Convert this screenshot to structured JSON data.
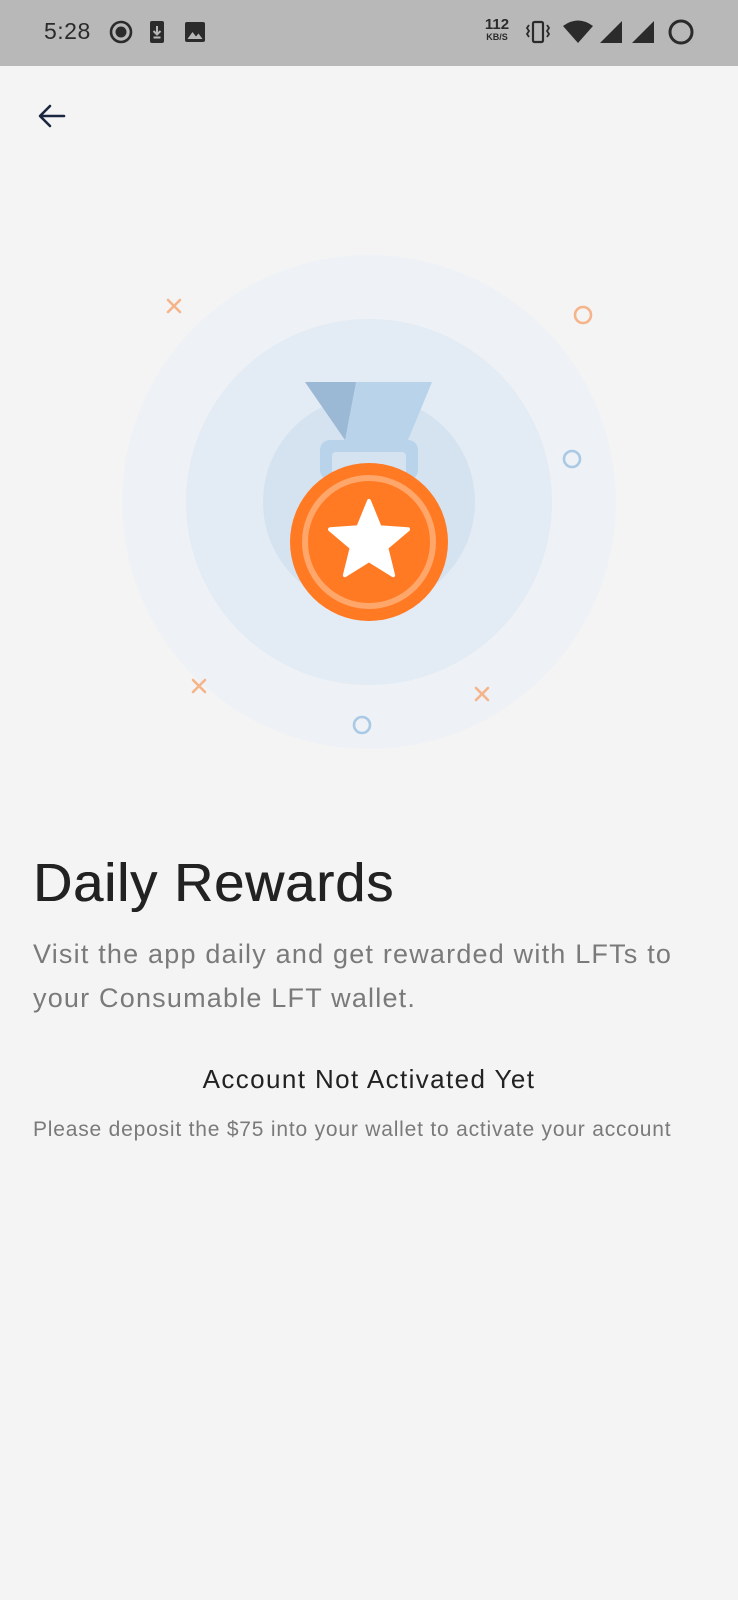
{
  "status_bar": {
    "time": "5:28",
    "net_speed_value": "112",
    "net_speed_unit": "KB/S",
    "icons": [
      "record-icon",
      "download-icon",
      "image-icon",
      "vibrate-icon",
      "wifi-icon",
      "signal-icon",
      "signal-icon",
      "loading-icon"
    ]
  },
  "header": {
    "back_icon": "arrow-left-icon"
  },
  "illustration": {
    "icon": "medal-star-icon",
    "colors": {
      "outer_circle": "#eef1f5",
      "middle_circle": "#e3ebf4",
      "inner_circle": "#d5e3f0",
      "ribbon_light": "#b8d3ea",
      "ribbon_dark": "#9bb8d4",
      "medal": "#ff7a22",
      "medal_ring": "#ffa66a",
      "cross_marks": "#f5b48a",
      "orange_circle": "#f5b48a",
      "blue_circles": "#a9c9e4"
    }
  },
  "content": {
    "title": "Daily Rewards",
    "description": "Visit the app daily and get rewarded with LFTs to your Consumable LFT wallet.",
    "status_heading": "Account Not Activated Yet",
    "status_message": "Please deposit the $75 into your wallet to activate your account"
  }
}
